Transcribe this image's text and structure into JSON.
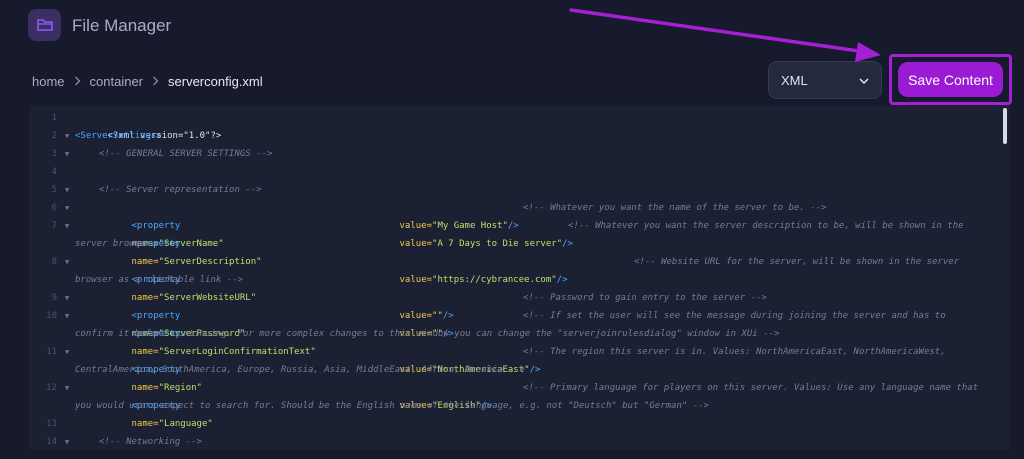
{
  "app": {
    "title": "File Manager",
    "icon": "folder-icon"
  },
  "breadcrumb": [
    "home",
    "container",
    "serverconfig.xml"
  ],
  "toolbar": {
    "language": "XML",
    "save_label": "Save Content"
  },
  "colors": {
    "accent": "#9b1bd4",
    "background": "#171a2c",
    "editor_bg": "#1c2033"
  },
  "editor": {
    "lines": [
      {
        "n": "1",
        "fold": false
      },
      {
        "n": "2",
        "fold": true
      },
      {
        "n": "3",
        "fold": true
      },
      {
        "n": "4",
        "fold": false
      },
      {
        "n": "5",
        "fold": true
      },
      {
        "n": "6",
        "fold": true
      },
      {
        "n": "7",
        "fold": true
      },
      {
        "n": "8",
        "fold": true
      },
      {
        "n": "9",
        "fold": true
      },
      {
        "n": "10",
        "fold": true
      },
      {
        "n": "11",
        "fold": true
      },
      {
        "n": "12",
        "fold": true
      },
      {
        "n": "13",
        "fold": false
      },
      {
        "n": "14",
        "fold": true
      }
    ],
    "text": {
      "l1": "<?xml version=\"1.0\"?>",
      "l2": "<ServerSettings>",
      "l3": "<!-- GENERAL SERVER SETTINGS -->",
      "l5": "<!-- Server representation -->",
      "p_open": "<property",
      "p_name_attr": "name=",
      "p_value_attr": "value=",
      "p_close": "/>",
      "l6_name": "\"ServerName\"",
      "l6_value": "\"My Game Host\"",
      "l6_comment": "<!-- Whatever you want the name of the server to be. -->",
      "l7_name": "\"ServerDescription\"",
      "l7_value": "\"A 7 Days to Die server\"",
      "l7_comment": "<!-- Whatever you want the server description to be, will be shown in the",
      "l7_wrap": "server browser. -->",
      "l8_name": "\"ServerWebsiteURL\"",
      "l8_value": "\"https://cybrancee.com\"",
      "l8_comment": "<!-- Website URL for the server, will be shown in the server",
      "l8_wrap": "browser as a clickable link -->",
      "l9_name": "\"ServerPassword\"",
      "l9_value": "\"\"",
      "l9_comment": "<!-- Password to gain entry to the server -->",
      "l10_name": "\"ServerLoginConfirmationText\"",
      "l10_value": "\"\"",
      "l10_comment": "<!-- If set the user will see the message during joining the server and has to",
      "l10_wrap": "confirm it before continuing. For more complex changes to this window you can change the \"serverjoinrulesdialog\" window in XUi -->",
      "l11_name": "\"Region\"",
      "l11_value": "\"NorthAmericaEast\"",
      "l11_comment": "<!-- The region this server is in. Values: NorthAmericaEast, NorthAmericaWest,",
      "l11_wrap": "CentralAmerica, SouthAmerica, Europe, Russia, Asia, MiddleEast, Africa, Oceania -->",
      "l12_name": "\"Language\"",
      "l12_value": "\"English\"",
      "l12_comment": "<!-- Primary language for players on this server. Values: Use any language name that",
      "l12_wrap": "you would users expect to search for. Should be the English name of the language, e.g. not \"Deutsch\" but \"German\" -->",
      "l14": "<!-- Networking -->"
    }
  }
}
